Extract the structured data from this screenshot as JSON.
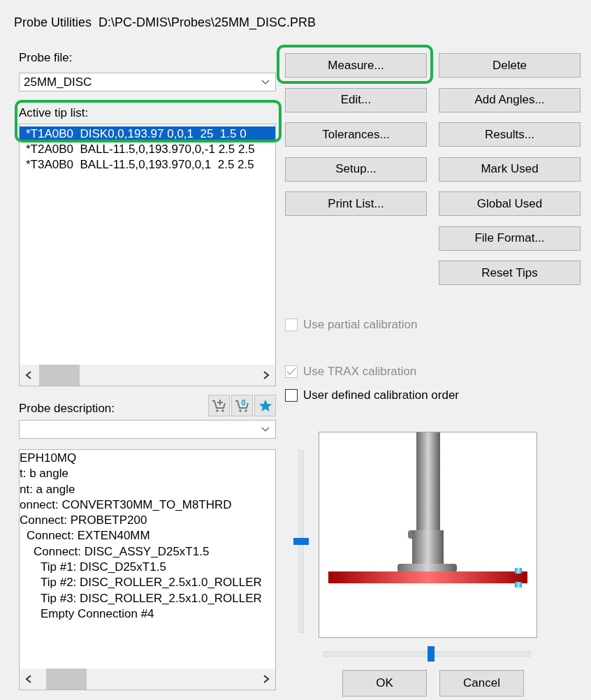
{
  "window": {
    "title": "Probe Utilities  D:\\PC-DMIS\\Probes\\25MM_DISC.PRB"
  },
  "probe_file": {
    "label": "Probe file:",
    "value": "25MM_DISC"
  },
  "tip_list": {
    "label": "Active tip list:",
    "highlighted": true,
    "rows": [
      {
        "text": "*T1A0B0  DISK0,0,193.97 0,0,1  25  1.5 0",
        "selected": true
      },
      {
        "text": "*T2A0B0  BALL-11.5,0,193.970,0,-1 2.5 2.5",
        "selected": false
      },
      {
        "text": "*T3A0B0  BALL-11.5,0,193.970,0,1  2.5 2.5",
        "selected": false
      }
    ]
  },
  "probe_description": {
    "label": "Probe description:"
  },
  "description_tree": [
    {
      "text": "EPH10MQ",
      "children": [
        {
          "text": "t: b angle",
          "children": [
            {
              "text": "nt: a angle",
              "children": [
                {
                  "text": "onnect: CONVERT30MM_TO_M8THRD",
                  "children": [
                    {
                      "text": "Connect: PROBETP200",
                      "children": [
                        {
                          "text": "Connect: EXTEN40MM",
                          "children": [
                            {
                              "text": "Connect: DISC_ASSY_D25xT1.5",
                              "children": [
                                {
                                  "text": "Tip #1: DISC_D25xT1.5"
                                },
                                {
                                  "text": "Tip #2: DISC_ROLLER_2.5x1.0_ROLLER"
                                },
                                {
                                  "text": "Tip #3: DISC_ROLLER_2.5x1.0_ROLLER"
                                },
                                {
                                  "text": "Empty Connection #4"
                                }
                              ]
                            }
                          ]
                        }
                      ]
                    }
                  ]
                }
              ]
            }
          ]
        }
      ]
    }
  ],
  "buttons_left": [
    {
      "label": "Measure...",
      "highlighted": true
    },
    {
      "label": "Edit...",
      "highlighted": false
    },
    {
      "label": "Tolerances...",
      "highlighted": false
    },
    {
      "label": "Setup...",
      "highlighted": false
    },
    {
      "label": "Print List...",
      "highlighted": false
    }
  ],
  "buttons_right": [
    {
      "label": "Delete",
      "highlighted": false
    },
    {
      "label": "Add Angles...",
      "highlighted": false
    },
    {
      "label": "Results...",
      "highlighted": false
    },
    {
      "label": "Mark Used",
      "highlighted": false
    },
    {
      "label": "Global Used",
      "highlighted": false
    },
    {
      "label": "File Format...",
      "highlighted": false
    },
    {
      "label": "Reset Tips",
      "highlighted": false
    }
  ],
  "options": [
    {
      "label": "Use partial calibration",
      "checked": false,
      "disabled": true
    },
    {
      "label": "Use TRAX calibration",
      "checked": true,
      "disabled": true
    },
    {
      "label": "User defined calibration order",
      "checked": false,
      "disabled": false
    }
  ],
  "preview": {
    "vertical_slider": {
      "level": 0.5
    },
    "horizontal_slider": {
      "level": 0.52
    }
  },
  "dialog_buttons": [
    "OK",
    "Cancel"
  ]
}
